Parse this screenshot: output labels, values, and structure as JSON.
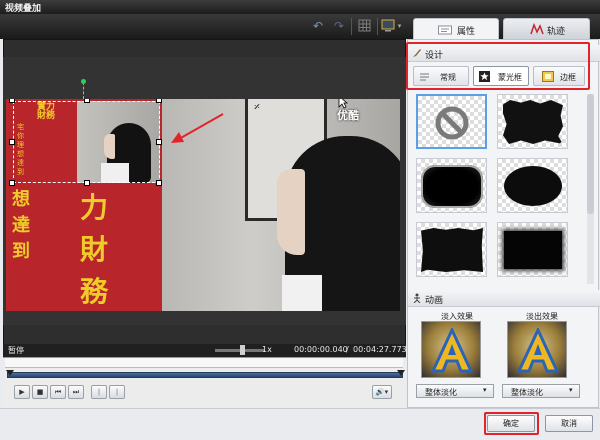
{
  "window": {
    "title": "视频叠加"
  },
  "tabs": {
    "properties": "属性",
    "track": "轨迹"
  },
  "design": {
    "title": "设计",
    "subtabs": [
      "常规",
      "蒙光框",
      "边框"
    ]
  },
  "animation": {
    "title": "动画",
    "fade_in": {
      "label": "淡入效果",
      "value": "整体淡化"
    },
    "fade_out": {
      "label": "淡出效果",
      "value": "整体淡化"
    }
  },
  "player": {
    "status": "暂停",
    "speed": "1x",
    "time_current": "00:00:00.040",
    "time_total": "00:04:27.773",
    "time_sep": "/"
  },
  "video_text": {
    "logo": "优酷",
    "banner_left_large": [
      "實力",
      "財務",
      "想",
      "達到"
    ],
    "banner_left_small": [
      "宅",
      "你",
      "理",
      "想",
      "達",
      "到"
    ],
    "banner_right": [
      "力",
      "財",
      "務"
    ],
    "overlay_banner_top": "實力財務",
    "overlay_banner_side": [
      "宅",
      "你",
      "理",
      "想",
      "達",
      "到"
    ]
  },
  "buttons": {
    "ok": "确定",
    "cancel": "取消"
  },
  "colors": {
    "highlight": "#e1242b",
    "selection": "#5aa0e8",
    "banner": "#b8252a",
    "banner_text": "#f0cc2a"
  }
}
